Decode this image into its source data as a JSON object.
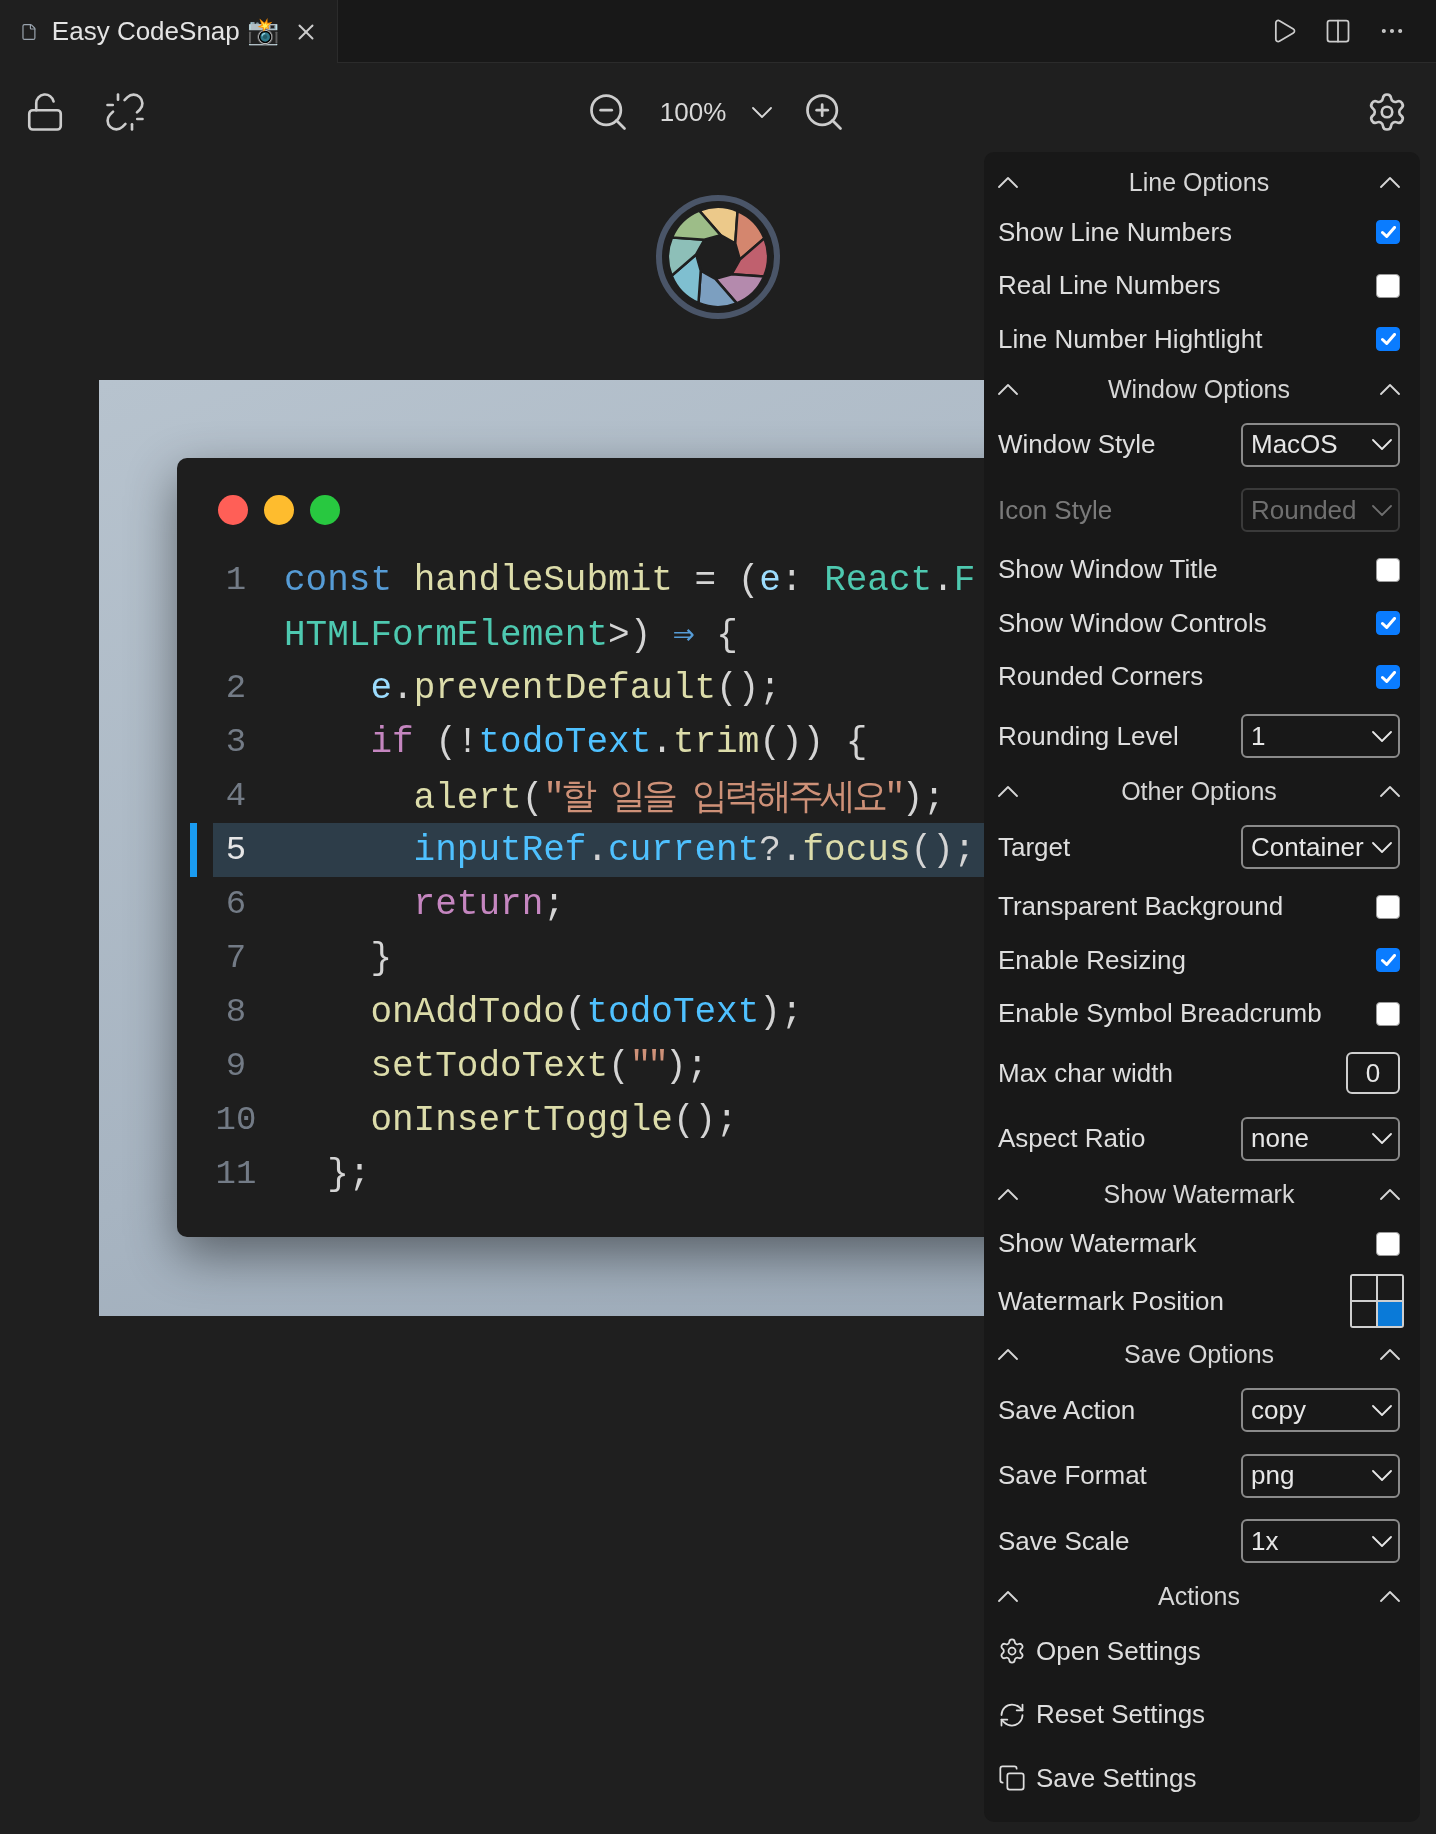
{
  "tab": {
    "title": "Easy CodeSnap 📸"
  },
  "toolbar": {
    "zoom": "100%"
  },
  "code_window": {
    "lines": [
      {
        "number": "1",
        "highlighted": false,
        "tokens": [
          {
            "text": "const",
            "kind": "storage"
          },
          {
            "text": " handleSubmit",
            "kind": "function"
          },
          {
            "text": " = (",
            "kind": "punct"
          },
          {
            "text": "e",
            "kind": "variable"
          },
          {
            "text": ": ",
            "kind": "punct"
          },
          {
            "text": "React",
            "kind": "type"
          },
          {
            "text": ".",
            "kind": "punct"
          },
          {
            "text": "F",
            "kind": "type"
          }
        ]
      },
      {
        "highlighted": false,
        "tokens": [
          {
            "text": "HTMLFormElement",
            "kind": "type"
          },
          {
            "text": ">) ",
            "kind": "punct"
          },
          {
            "text": "⇒",
            "kind": "storage"
          },
          {
            "text": " {",
            "kind": "punct"
          }
        ]
      },
      {
        "number": "2",
        "highlighted": false,
        "tokens": [
          {
            "text": "    e",
            "kind": "variable"
          },
          {
            "text": ".",
            "kind": "punct"
          },
          {
            "text": "preventDefault",
            "kind": "function"
          },
          {
            "text": "();",
            "kind": "punct"
          }
        ]
      },
      {
        "number": "3",
        "highlighted": false,
        "tokens": [
          {
            "text": "    if",
            "kind": "control"
          },
          {
            "text": " (!",
            "kind": "punct"
          },
          {
            "text": "todoText",
            "kind": "property"
          },
          {
            "text": ".",
            "kind": "punct"
          },
          {
            "text": "trim",
            "kind": "function"
          },
          {
            "text": "()) {",
            "kind": "punct"
          }
        ]
      },
      {
        "number": "4",
        "highlighted": false,
        "tokens": [
          {
            "text": "      alert",
            "kind": "function"
          },
          {
            "text": "(",
            "kind": "punct"
          },
          {
            "text": "\"할 일을 입력해주세요\"",
            "kind": "string"
          },
          {
            "text": ");",
            "kind": "punct"
          }
        ]
      },
      {
        "number": "5",
        "highlighted": true,
        "tokens": [
          {
            "text": "      inputRef",
            "kind": "property"
          },
          {
            "text": ".",
            "kind": "punct"
          },
          {
            "text": "current",
            "kind": "property"
          },
          {
            "text": "?.",
            "kind": "punct"
          },
          {
            "text": "focus",
            "kind": "function"
          },
          {
            "text": "();",
            "kind": "punct"
          }
        ]
      },
      {
        "number": "6",
        "highlighted": false,
        "tokens": [
          {
            "text": "      return",
            "kind": "control"
          },
          {
            "text": ";",
            "kind": "punct"
          }
        ]
      },
      {
        "number": "7",
        "highlighted": false,
        "tokens": [
          {
            "text": "    }",
            "kind": "punct"
          }
        ]
      },
      {
        "number": "8",
        "highlighted": false,
        "tokens": [
          {
            "text": "    onAddTodo",
            "kind": "function"
          },
          {
            "text": "(",
            "kind": "punct"
          },
          {
            "text": "todoText",
            "kind": "property"
          },
          {
            "text": ");",
            "kind": "punct"
          }
        ]
      },
      {
        "number": "9",
        "highlighted": false,
        "tokens": [
          {
            "text": "    setTodoText",
            "kind": "function"
          },
          {
            "text": "(",
            "kind": "punct"
          },
          {
            "text": "\"\"",
            "kind": "string"
          },
          {
            "text": ");",
            "kind": "punct"
          }
        ]
      },
      {
        "number": "10",
        "highlighted": false,
        "tokens": [
          {
            "text": "    onInsertToggle",
            "kind": "function"
          },
          {
            "text": "();",
            "kind": "punct"
          }
        ]
      },
      {
        "number": "11",
        "highlighted": false,
        "tokens": [
          {
            "text": "  };",
            "kind": "punct"
          }
        ]
      }
    ]
  },
  "settings_panel": {
    "sections": [
      {
        "title": "Line Options",
        "rows": [
          {
            "kind": "checkbox",
            "label": "Show Line Numbers",
            "checked": true,
            "disabled": false
          },
          {
            "kind": "checkbox",
            "label": "Real Line Numbers",
            "checked": false,
            "disabled": false
          },
          {
            "kind": "checkbox",
            "label": "Line Number Hightlight",
            "checked": true,
            "disabled": false
          }
        ]
      },
      {
        "title": "Window Options",
        "rows": [
          {
            "kind": "select",
            "label": "Window Style",
            "value": "MacOS",
            "disabled": false
          },
          {
            "kind": "select",
            "label": "Icon Style",
            "value": "Rounded",
            "disabled": true
          },
          {
            "kind": "checkbox",
            "label": "Show Window Title",
            "checked": false,
            "disabled": false
          },
          {
            "kind": "checkbox",
            "label": "Show Window Controls",
            "checked": true,
            "disabled": false
          },
          {
            "kind": "checkbox",
            "label": "Rounded Corners",
            "checked": true,
            "disabled": false
          },
          {
            "kind": "select",
            "label": "Rounding Level",
            "value": "1",
            "disabled": false
          }
        ]
      },
      {
        "title": "Other Options",
        "rows": [
          {
            "kind": "select",
            "label": "Target",
            "value": "Container",
            "disabled": false
          },
          {
            "kind": "checkbox",
            "label": "Transparent Background",
            "checked": false,
            "disabled": false
          },
          {
            "kind": "checkbox",
            "label": "Enable Resizing",
            "checked": true,
            "disabled": false
          },
          {
            "kind": "checkbox",
            "label": "Enable Symbol Breadcrumb",
            "checked": false,
            "disabled": false
          },
          {
            "kind": "number",
            "label": "Max char width",
            "value": "0",
            "disabled": false
          },
          {
            "kind": "select",
            "label": "Aspect Ratio",
            "value": "none",
            "disabled": false
          }
        ]
      },
      {
        "title": "Show Watermark",
        "rows": [
          {
            "kind": "checkbox",
            "label": "Show Watermark",
            "checked": false,
            "disabled": false
          },
          {
            "kind": "position",
            "label": "Watermark Position",
            "disabled": false,
            "cells": [
              {
                "selected": false
              },
              {
                "selected": false
              },
              {
                "selected": false
              },
              {
                "selected": true
              }
            ]
          }
        ]
      },
      {
        "title": "Save Options",
        "rows": [
          {
            "kind": "select",
            "label": "Save Action",
            "value": "copy",
            "disabled": false
          },
          {
            "kind": "select",
            "label": "Save Format",
            "value": "png",
            "disabled": false
          },
          {
            "kind": "select",
            "label": "Save Scale",
            "value": "1x",
            "disabled": false
          }
        ]
      },
      {
        "title": "Actions",
        "rows": [
          {
            "kind": "action",
            "label": "Open Settings",
            "disabled": false
          },
          {
            "kind": "action",
            "label": "Reset Settings",
            "disabled": false
          },
          {
            "kind": "action",
            "label": "Save Settings",
            "disabled": false
          }
        ]
      }
    ]
  }
}
